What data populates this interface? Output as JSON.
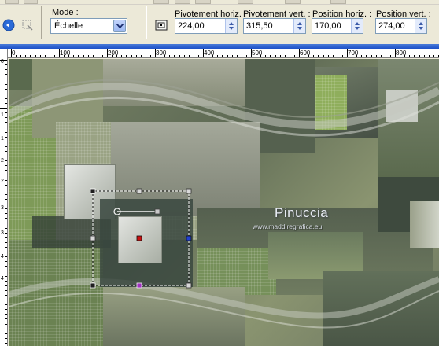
{
  "toolbar": {
    "mode_label": "Mode :",
    "mode_value": "Échelle",
    "pivot_h_label": "Pivotement horiz. :",
    "pivot_h_value": "224,00",
    "pivot_v_label": "Pivotement vert. :",
    "pivot_v_value": "315,50",
    "pos_h_label": "Position horiz. :",
    "pos_h_value": "170,00",
    "pos_v_label": "Position vert. :",
    "pos_v_value": "274,00"
  },
  "ruler": {
    "h_labels": [
      "0",
      "100",
      "200",
      "300",
      "400",
      "500",
      "600",
      "700",
      "800"
    ],
    "v_labels": [
      "0",
      "1",
      "1",
      "2",
      "2",
      "3",
      "3",
      "4",
      "4"
    ]
  },
  "watermark": {
    "name": "Pinuccia",
    "url": "www.maddiregrafica.eu"
  },
  "colors": {
    "accent_blue": "#1c50c8",
    "canvas_green": "#6f7a60",
    "handle_red": "#cc1010",
    "handle_blue": "#2040d0",
    "handle_purple": "#a030c0"
  },
  "icons": [
    "undo-icon",
    "reset-icon",
    "chevron-down-icon",
    "pivot-center-icon",
    "spin-arrows-icon"
  ]
}
